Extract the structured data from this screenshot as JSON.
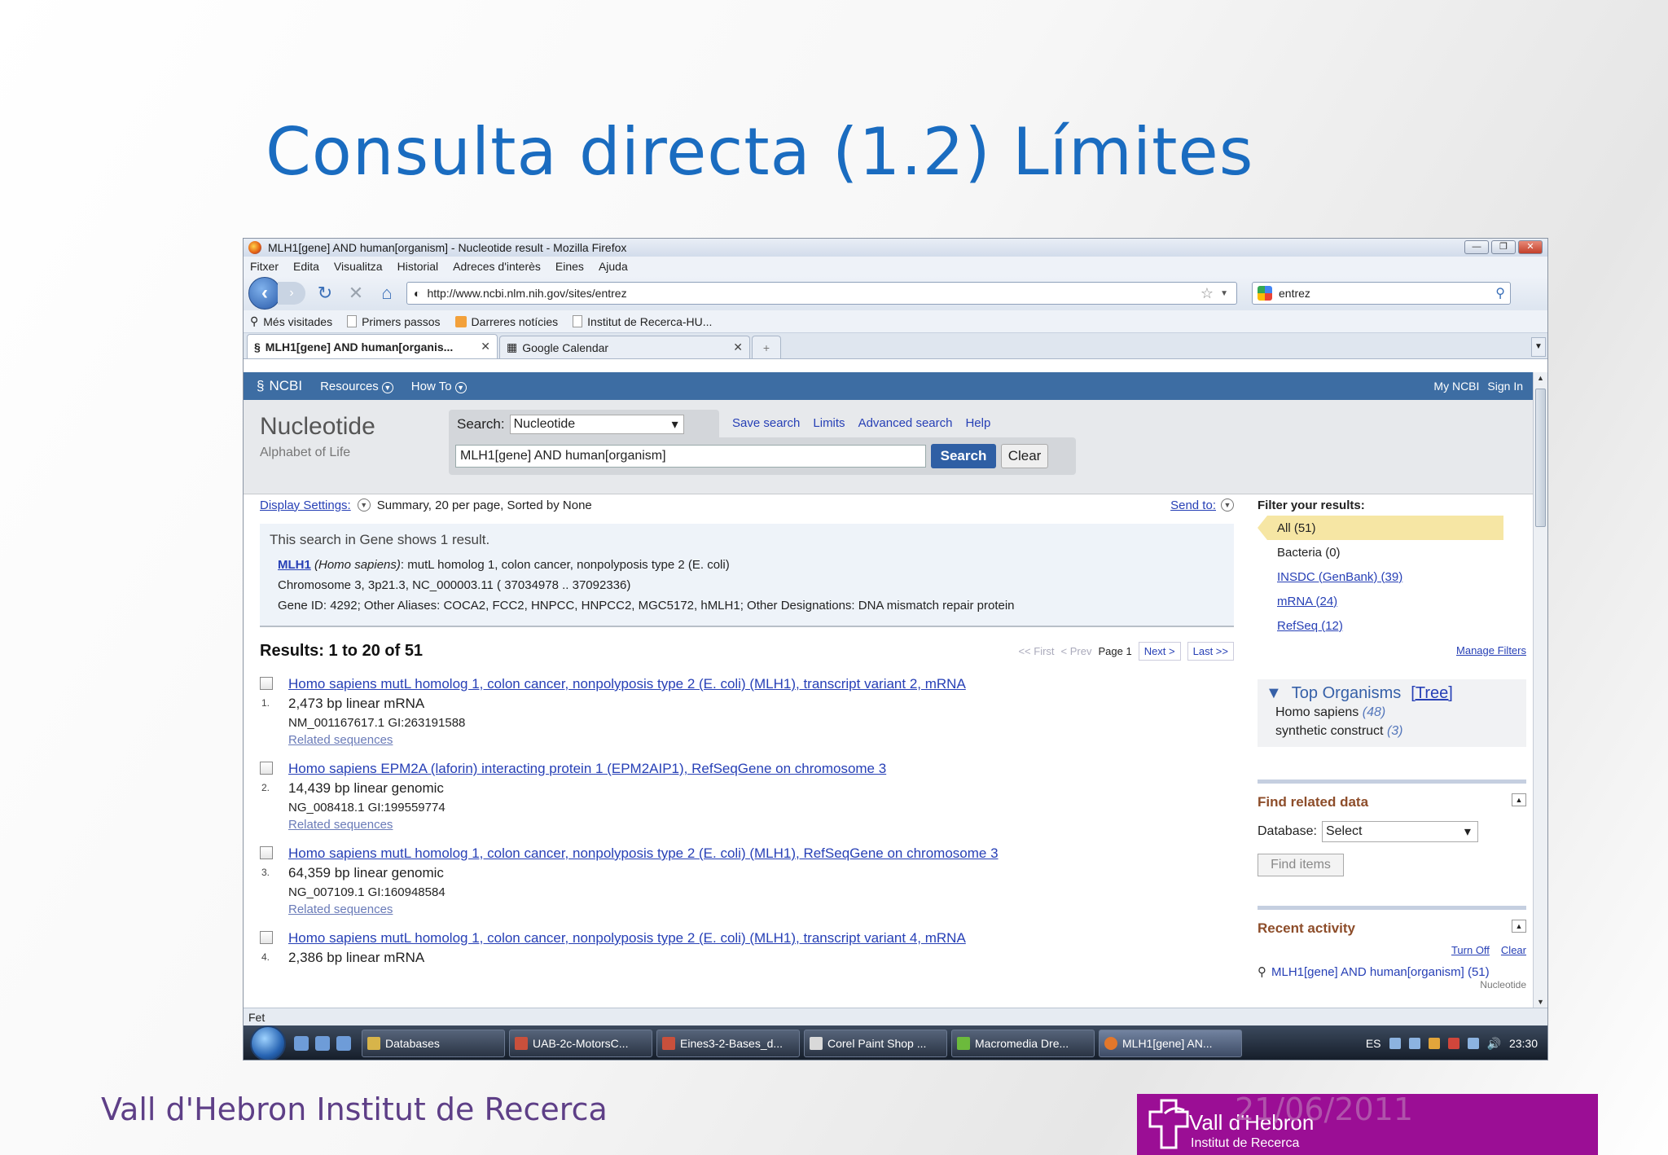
{
  "slide": {
    "title": "Consulta directa (1.2) Límites",
    "footer": "Vall d'Hebron Institut de Recerca",
    "date": "21/06/2011",
    "logo_name": "Vall d'Hebron",
    "logo_sub": "Institut de Recerca"
  },
  "window": {
    "title": "MLH1[gene] AND human[organism] - Nucleotide result - Mozilla Firefox",
    "menu": [
      "Fitxer",
      "Edita",
      "Visualitza",
      "Historial",
      "Adreces d'interès",
      "Eines",
      "Ajuda"
    ],
    "url": "http://www.ncbi.nlm.nih.gov/sites/entrez",
    "search_engine_value": "entrez",
    "bookmarks": [
      "Més visitades",
      "Primers passos",
      "Darreres notícies",
      "Institut de Recerca-HU..."
    ],
    "tabs": [
      "MLH1[gene] AND human[organis...",
      "Google Calendar"
    ],
    "status": "Fet"
  },
  "ncbi": {
    "logo": "NCBI",
    "nav": [
      "Resources",
      "How To"
    ],
    "my_ncbi": "My NCBI",
    "sign_in": "Sign In",
    "db_title": "Nucleotide",
    "db_sub": "Alphabet of Life",
    "search_label": "Search:",
    "search_db": "Nucleotide",
    "links": [
      "Save search",
      "Limits",
      "Advanced search",
      "Help"
    ],
    "query": "MLH1[gene] AND human[organism]",
    "search_btn": "Search",
    "clear_btn": "Clear"
  },
  "display": {
    "settings_label": "Display Settings:",
    "settings_value": "Summary, 20 per page, Sorted by None",
    "send_to": "Send to:"
  },
  "gene": {
    "header": "This search in Gene shows 1 result.",
    "symbol": "MLH1",
    "organism": "(Homo sapiens)",
    "desc": ": mutL homolog 1, colon cancer, nonpolyposis type 2 (E. coli)",
    "chromosome": "Chromosome 3, 3p21.3, NC_000003.11 ( 37034978 .. 37092336)",
    "ids": "Gene ID: 4292; Other Aliases: COCA2, FCC2, HNPCC, HNPCC2, MGC5172, hMLH1; Other Designations: DNA mismatch repair protein"
  },
  "results": {
    "header": "Results: 1 to 20 of 51",
    "pager": {
      "first": "<< First",
      "prev": "< Prev",
      "page": "Page 1",
      "next": "Next >",
      "last": "Last >>"
    },
    "items": [
      {
        "num": "1.",
        "title": "Homo sapiens mutL homolog 1, colon cancer, nonpolyposis type 2 (E. coli) (MLH1), transcript variant 2, mRNA",
        "line1": "2,473 bp linear mRNA",
        "line2": "NM_001167617.1 GI:263191588",
        "related": "Related sequences"
      },
      {
        "num": "2.",
        "title": "Homo sapiens EPM2A (laforin) interacting protein 1 (EPM2AIP1), RefSeqGene on chromosome 3",
        "line1": "14,439 bp linear genomic",
        "line2": "NG_008418.1 GI:199559774",
        "related": "Related sequences"
      },
      {
        "num": "3.",
        "title": "Homo sapiens mutL homolog 1, colon cancer, nonpolyposis type 2 (E. coli) (MLH1), RefSeqGene on chromosome 3",
        "line1": "64,359 bp linear genomic",
        "line2": "NG_007109.1 GI:160948584",
        "related": "Related sequences"
      },
      {
        "num": "4.",
        "title": "Homo sapiens mutL homolog 1, colon cancer, nonpolyposis type 2 (E. coli) (MLH1), transcript variant 4, mRNA",
        "line1": "2,386 bp linear mRNA",
        "line2": "",
        "related": ""
      }
    ]
  },
  "sidebar": {
    "filter_header": "Filter your results:",
    "filters": [
      "All (51)",
      "Bacteria (0)",
      "INSDC (GenBank) (39)",
      "mRNA (24)",
      "RefSeq (12)"
    ],
    "manage": "Manage Filters",
    "top_org_title": "Top Organisms",
    "top_org_tree": "[Tree]",
    "organisms": [
      {
        "name": "Homo sapiens",
        "count": "(48)"
      },
      {
        "name": "synthetic construct",
        "count": "(3)"
      }
    ],
    "find_related": "Find related data",
    "database_label": "Database:",
    "database_value": "Select",
    "find_items": "Find items",
    "recent_activity": "Recent activity",
    "turn_off": "Turn Off",
    "clear": "Clear",
    "recent_query": "MLH1[gene] AND human[organism] (51)",
    "recent_db": "Nucleotide"
  },
  "taskbar": {
    "tasks": [
      "Databases",
      "UAB-2c-MotorsC...",
      "Eines3-2-Bases_d...",
      "Corel Paint Shop ...",
      "Macromedia Dre...",
      "MLH1[gene] AN..."
    ],
    "lang": "ES",
    "time": "23:30"
  }
}
